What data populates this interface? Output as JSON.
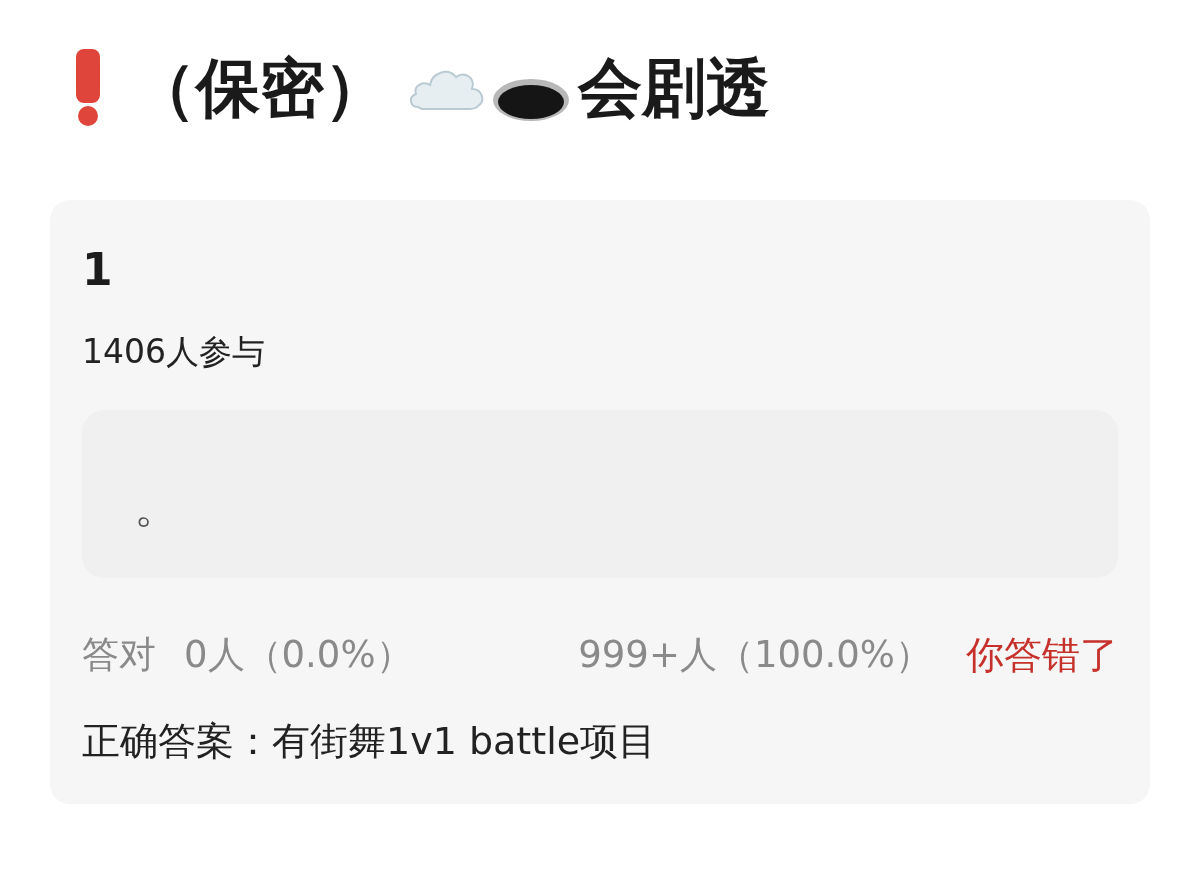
{
  "title": {
    "text": "（保密）",
    "suffix": "会剧透"
  },
  "question": {
    "number": "1",
    "participants": "1406人参与",
    "option": {
      "text": "。"
    },
    "stats": {
      "correct_label": "答对",
      "correct_count": "0人（0.0%）",
      "wrong_count": "999+人（100.0%）"
    },
    "result": {
      "text": "你答错了",
      "correct": false
    },
    "answer": "正确答案：有街舞1v1 battle项目"
  }
}
